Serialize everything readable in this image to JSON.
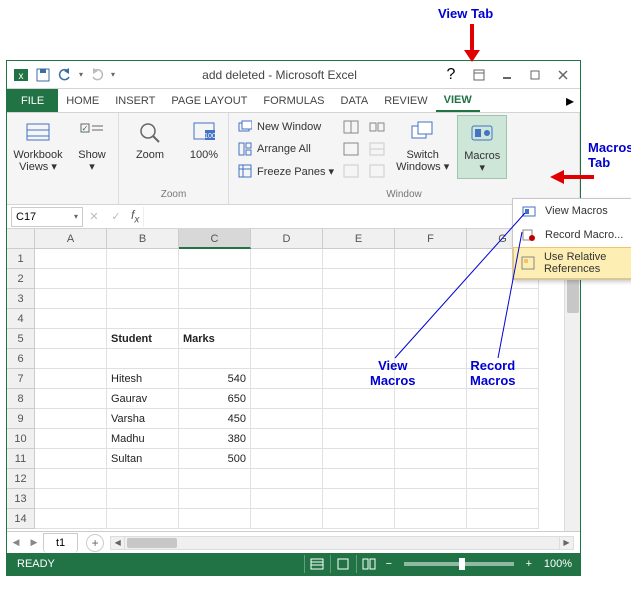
{
  "annotations": {
    "view_tab": "View Tab",
    "macros_tab_l1": "Macros",
    "macros_tab_l2": "Tab",
    "view_macros_l1": "View",
    "view_macros_l2": "Macros",
    "record_macros_l1": "Record",
    "record_macros_l2": "Macros"
  },
  "window": {
    "title": "add deleted - Microsoft Excel"
  },
  "tabs": {
    "file": "FILE",
    "home": "HOME",
    "insert": "INSERT",
    "page_layout": "PAGE LAYOUT",
    "formulas": "FORMULAS",
    "data": "DATA",
    "review": "REVIEW",
    "view": "VIEW"
  },
  "ribbon": {
    "workbook_views_l1": "Workbook",
    "workbook_views_l2": "Views ▾",
    "show": "Show",
    "show_sub": "▾",
    "zoom": "Zoom",
    "pct100": "100%",
    "new_window": "New Window",
    "arrange_all": "Arrange All",
    "freeze_panes": "Freeze Panes ▾",
    "switch_windows_l1": "Switch",
    "switch_windows_l2": "Windows ▾",
    "macros": "Macros",
    "macros_sub": "▾",
    "group_zoom": "Zoom",
    "group_window": "Window"
  },
  "macros_menu": {
    "view": "View Macros",
    "record": "Record Macro...",
    "relative": "Use Relative References"
  },
  "namebox": "C17",
  "columns": [
    "A",
    "B",
    "C",
    "D",
    "E",
    "F",
    "G"
  ],
  "rows": [
    "1",
    "2",
    "3",
    "4",
    "5",
    "6",
    "7",
    "8",
    "9",
    "10",
    "11",
    "12",
    "13",
    "14"
  ],
  "cells": {
    "b5": "Student",
    "c5": "Marks",
    "b7": "Hitesh",
    "c7": "540",
    "b8": "Gaurav",
    "c8": "650",
    "b9": "Varsha",
    "c9": "450",
    "b10": "Madhu",
    "c10": "380",
    "b11": "Sultan",
    "c11": "500"
  },
  "sheet": {
    "name": "t1",
    "add": "+"
  },
  "status": {
    "ready": "READY",
    "zoom": "100%"
  }
}
